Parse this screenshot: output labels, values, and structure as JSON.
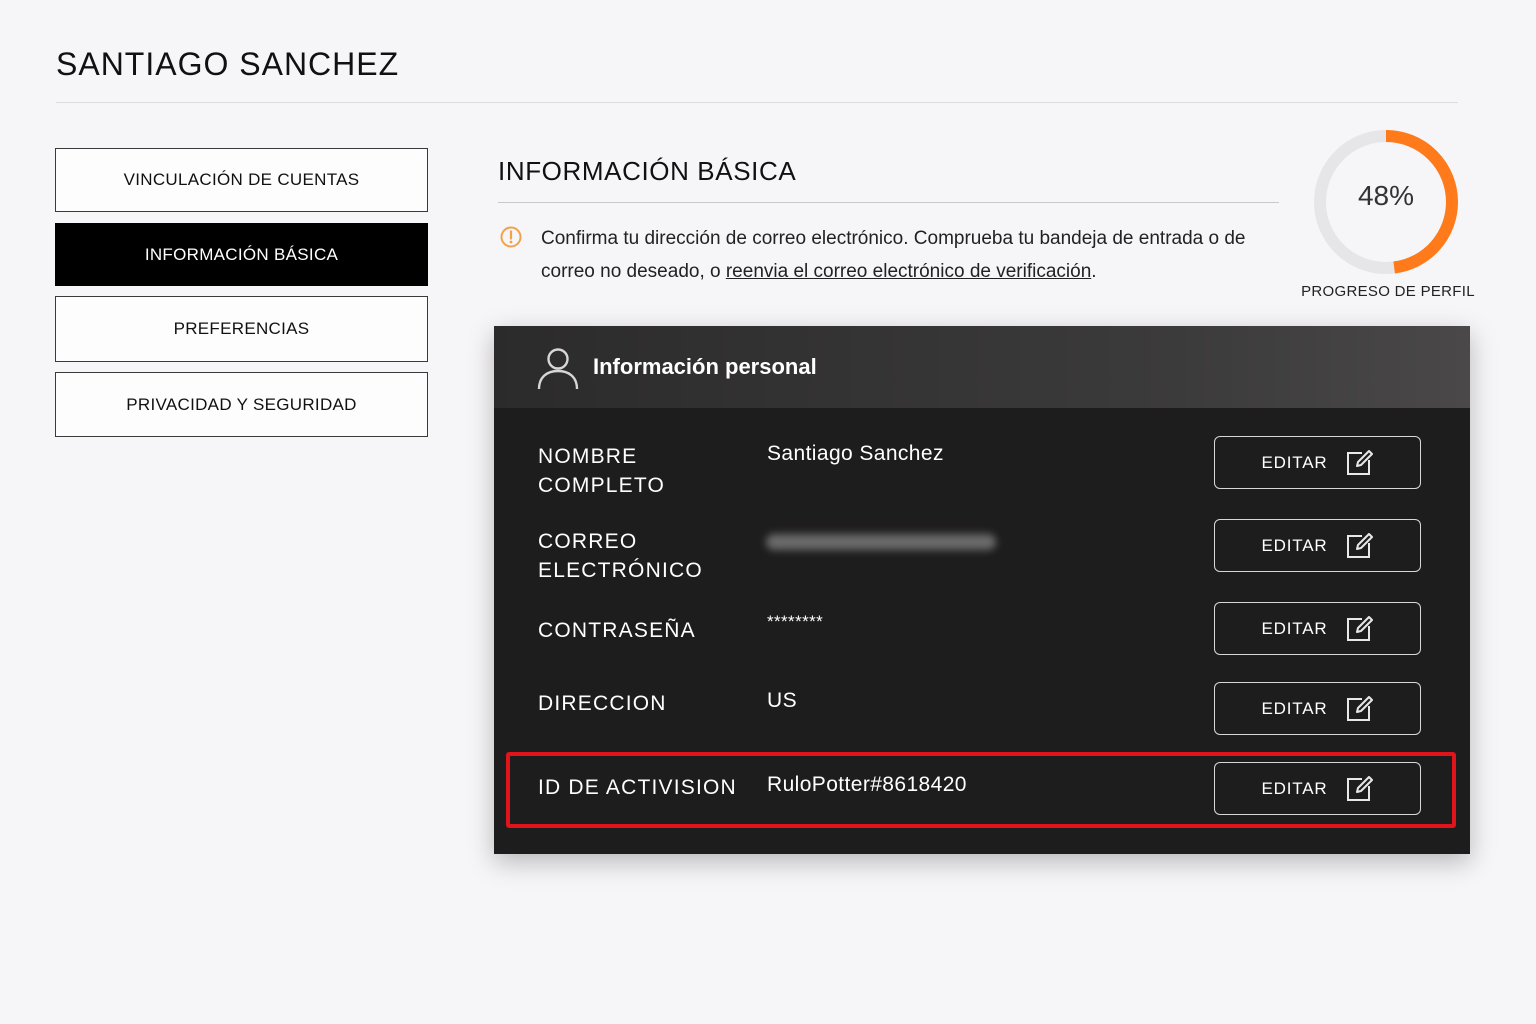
{
  "header": {
    "title": "SANTIAGO SANCHEZ"
  },
  "sidebar": {
    "items": [
      {
        "label": "VINCULACIÓN DE CUENTAS",
        "active": false
      },
      {
        "label": "INFORMACIÓN BÁSICA",
        "active": true
      },
      {
        "label": "PREFERENCIAS",
        "active": false
      },
      {
        "label": "PRIVACIDAD Y SEGURIDAD",
        "active": false
      }
    ]
  },
  "main": {
    "section_title": "INFORMACIÓN BÁSICA",
    "notice": {
      "icon": "warning-circle-icon",
      "text_before": "Confirma tu dirección de correo electrónico. Comprueba tu bandeja de entrada o de correo no deseado, o ",
      "link_text": "reenvia el correo electrónico de verificación",
      "text_after": "."
    },
    "progress": {
      "value_text": "48%",
      "fraction": 0.48,
      "label": "PROGRESO DE PERFIL",
      "color": "#ff7a1a",
      "track_color": "#e6e5e7"
    }
  },
  "card": {
    "title": "Información personal",
    "icon": "user-icon",
    "fields": [
      {
        "label": "NOMBRE COMPLETO",
        "value": "Santiago Sanchez",
        "button": "EDITAR"
      },
      {
        "label": "CORREO ELECTRÓNICO",
        "value": "",
        "button": "EDITAR"
      },
      {
        "label": "CONTRASEÑA",
        "value": "********",
        "button": "EDITAR"
      },
      {
        "label": "DIRECCION",
        "value": "US",
        "button": "EDITAR"
      },
      {
        "label": "ID DE ACTIVISION",
        "value": "RuloPotter#8618420",
        "button": "EDITAR"
      }
    ],
    "highlight_color": "#e0141b"
  }
}
